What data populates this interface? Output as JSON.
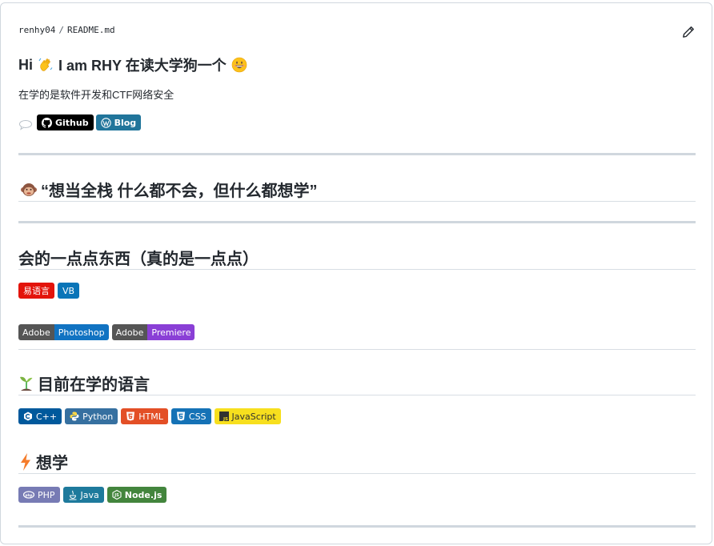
{
  "breadcrumb": {
    "owner": "renhy04",
    "separator": "/",
    "file": "README.md"
  },
  "title": {
    "text_before": "Hi",
    "text_after": "I am RHY 在读大学狗一个"
  },
  "intro": "在学的是软件开发和CTF网络安全",
  "social": [
    {
      "label": "Github",
      "icon": "github-icon",
      "color": "#000000"
    },
    {
      "label": "Blog",
      "icon": "wordpress-icon",
      "color": "#21759b"
    }
  ],
  "quote_heading": "“想当全栈 什么都不会，但什么都想学”",
  "skills_heading": "会的一点点东西（真的是一点点）",
  "skills_row1": [
    {
      "label": "易语言",
      "color": "#e3140b"
    },
    {
      "label": "VB",
      "color": "#0a75b8"
    }
  ],
  "skills_row2": [
    {
      "left": "Adobe",
      "right": "Photoshop",
      "left_color": "#555555",
      "right_color": "#1173c2"
    },
    {
      "left": "Adobe",
      "right": "Premiere",
      "left_color": "#555555",
      "right_color": "#8a3fd6"
    }
  ],
  "learning_heading": "目前在学的语言",
  "learning": [
    {
      "label": "C++",
      "icon": "cpp-icon",
      "color": "#00599c",
      "text_color": "#ffffff"
    },
    {
      "label": "Python",
      "icon": "python-icon",
      "color": "#3670a0",
      "text_color": "#ffffff"
    },
    {
      "label": "HTML",
      "icon": "html5-icon",
      "color": "#e34f26",
      "text_color": "#ffffff"
    },
    {
      "label": "CSS",
      "icon": "css3-icon",
      "color": "#1572b6",
      "text_color": "#ffffff"
    },
    {
      "label": "JavaScript",
      "icon": "javascript-icon",
      "color": "#f7df1e",
      "text_color": "#323330"
    }
  ],
  "want_heading": "想学",
  "want": [
    {
      "label": "PHP",
      "icon": "php-icon",
      "color": "#777bb4"
    },
    {
      "label": "Java",
      "icon": "java-icon",
      "color": "#1e7a9c"
    },
    {
      "label": "Node.js",
      "icon": "nodejs-icon",
      "color": "#43853d"
    }
  ]
}
